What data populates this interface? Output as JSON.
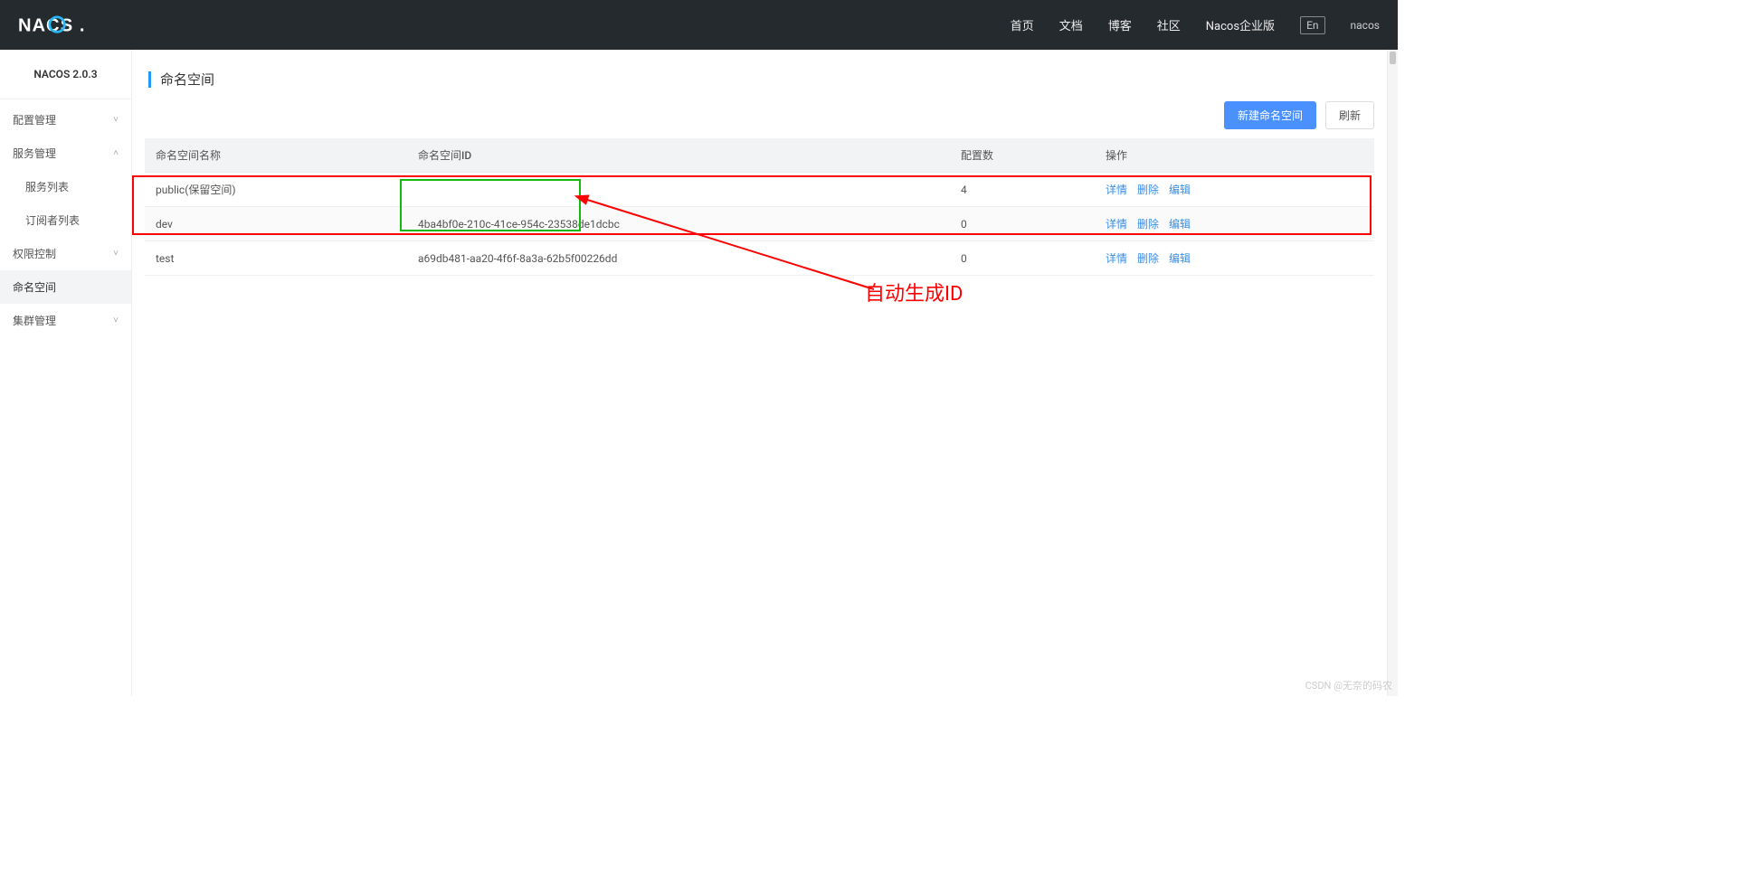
{
  "header": {
    "logo_text": "NACOS.",
    "nav": {
      "home": "首页",
      "docs": "文档",
      "blog": "博客",
      "community": "社区",
      "enterprise": "Nacos企业版"
    },
    "lang": "En",
    "user": "nacos"
  },
  "sidebar": {
    "version": "NACOS 2.0.3",
    "items": [
      {
        "label": "配置管理",
        "caret": "˅",
        "kind": "group"
      },
      {
        "label": "服务管理",
        "caret": "˄",
        "kind": "group"
      },
      {
        "label": "服务列表",
        "kind": "sub"
      },
      {
        "label": "订阅者列表",
        "kind": "sub"
      },
      {
        "label": "权限控制",
        "caret": "˅",
        "kind": "group"
      },
      {
        "label": "命名空间",
        "kind": "group",
        "active": true
      },
      {
        "label": "集群管理",
        "caret": "˅",
        "kind": "group"
      }
    ]
  },
  "page": {
    "title": "命名空间"
  },
  "toolbar": {
    "create": "新建命名空间",
    "refresh": "刷新"
  },
  "table": {
    "headers": {
      "name": "命名空间名称",
      "id": "命名空间ID",
      "count": "配置数",
      "ops": "操作"
    },
    "op_labels": {
      "detail": "详情",
      "delete": "删除",
      "edit": "编辑"
    },
    "rows": [
      {
        "name": "public(保留空间)",
        "id": "",
        "count": "4"
      },
      {
        "name": "dev",
        "id": "4ba4bf0e-210c-41ce-954c-23538de1dcbc",
        "count": "0"
      },
      {
        "name": "test",
        "id": "a69db481-aa20-4f6f-8a3a-62b5f00226dd",
        "count": "0"
      }
    ]
  },
  "annotation": {
    "label": "自动生成ID"
  },
  "watermark": "CSDN @无奈的码农"
}
